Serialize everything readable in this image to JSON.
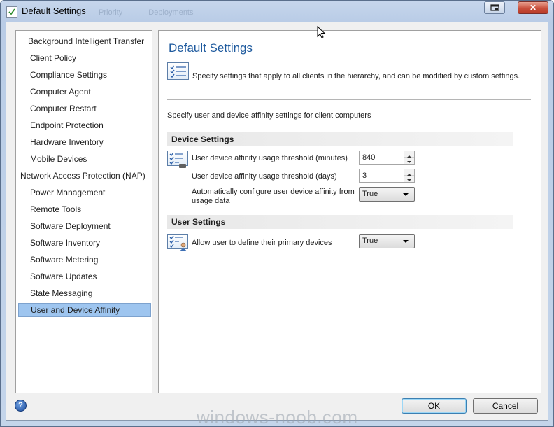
{
  "window": {
    "title": "Default Settings",
    "ghost_tabs": [
      "Priority",
      "Deployments"
    ]
  },
  "nav": {
    "items": [
      {
        "label": "Background Intelligent Transfer",
        "selected": false
      },
      {
        "label": "Client Policy",
        "selected": false
      },
      {
        "label": "Compliance Settings",
        "selected": false
      },
      {
        "label": "Computer Agent",
        "selected": false
      },
      {
        "label": "Computer Restart",
        "selected": false
      },
      {
        "label": "Endpoint Protection",
        "selected": false
      },
      {
        "label": "Hardware Inventory",
        "selected": false
      },
      {
        "label": "Mobile Devices",
        "selected": false
      },
      {
        "label": "Network Access Protection (NAP)",
        "selected": false
      },
      {
        "label": "Power Management",
        "selected": false
      },
      {
        "label": "Remote Tools",
        "selected": false
      },
      {
        "label": "Software Deployment",
        "selected": false
      },
      {
        "label": "Software Inventory",
        "selected": false
      },
      {
        "label": "Software Metering",
        "selected": false
      },
      {
        "label": "Software Updates",
        "selected": false
      },
      {
        "label": "State Messaging",
        "selected": false
      },
      {
        "label": "User and Device Affinity",
        "selected": true
      }
    ]
  },
  "main": {
    "title": "Default Settings",
    "description": "Specify settings that apply to all clients in the hierarchy, and can be modified by custom settings.",
    "intro": "Specify user and device affinity settings for client computers",
    "device_settings": {
      "header": "Device Settings",
      "threshold_minutes_label": "User device affinity usage threshold (minutes)",
      "threshold_minutes_value": "840",
      "threshold_days_label": "User device affinity usage threshold (days)",
      "threshold_days_value": "3",
      "auto_configure_label_line1": "Automatically configure user device affinity from",
      "auto_configure_label_line2": "usage data",
      "auto_configure_value": "True"
    },
    "user_settings": {
      "header": "User Settings",
      "allow_primary_label": "Allow user to define their primary devices",
      "allow_primary_value": "True"
    }
  },
  "footer": {
    "help_glyph": "?",
    "ok_label": "OK",
    "cancel_label": "Cancel"
  },
  "watermark": "windows-noob.com",
  "colors": {
    "accent_title": "#1e5a9e",
    "selection": "#9ec5ef",
    "close_button": "#c9503d"
  }
}
